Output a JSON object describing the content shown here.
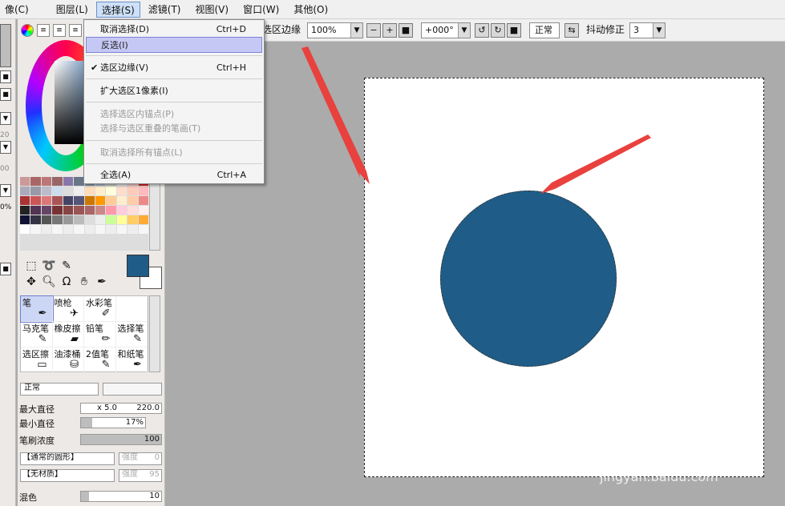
{
  "menubar": {
    "items": [
      "像(C)",
      "图层(L)",
      "选择(S)",
      "滤镜(T)",
      "视图(V)",
      "窗口(W)",
      "其他(O)"
    ]
  },
  "toolbar": {
    "selection_edge_label": "选区边缘",
    "zoom": "100%",
    "angle": "+000°",
    "blend": "正常",
    "stabilizer_label": "抖动修正",
    "stabilizer_value": "3"
  },
  "select_menu": {
    "items": [
      {
        "label": "取消选择(D)",
        "shortcut": "Ctrl+D",
        "state": "normal"
      },
      {
        "label": "反选(I)",
        "shortcut": "",
        "state": "highlighted"
      },
      {
        "label": "选区边缘(V)",
        "shortcut": "Ctrl+H",
        "state": "checked"
      },
      {
        "label": "扩大选区1像素(I)",
        "shortcut": "",
        "state": "normal"
      },
      {
        "label": "选择选区内锚点(P)",
        "shortcut": "",
        "state": "disabled"
      },
      {
        "label": "选择与选区重叠的笔画(T)",
        "shortcut": "",
        "state": "disabled"
      },
      {
        "label": "取消选择所有锚点(L)",
        "shortcut": "",
        "state": "disabled"
      },
      {
        "label": "全选(A)",
        "shortcut": "Ctrl+A",
        "state": "normal"
      }
    ]
  },
  "left_edge": {
    "values": [
      "20",
      "00",
      "0%"
    ]
  },
  "colors": {
    "foreground": "#1f5d88",
    "background": "#ffffff",
    "accent_highlight": "#c5c8f4"
  },
  "brushes": [
    {
      "name": "笔",
      "icon": "pen-icon"
    },
    {
      "name": "喷枪",
      "icon": "airbrush-icon"
    },
    {
      "name": "水彩笔",
      "icon": "watercolor-icon"
    },
    {
      "name": "",
      "icon": ""
    },
    {
      "name": "马克笔",
      "icon": "marker-icon"
    },
    {
      "name": "橡皮擦",
      "icon": "eraser-icon"
    },
    {
      "name": "铅笔",
      "icon": "pencil-icon"
    },
    {
      "name": "选择笔",
      "icon": "select-pen-icon"
    },
    {
      "name": "选区擦",
      "icon": "select-eraser-icon"
    },
    {
      "name": "油漆桶",
      "icon": "bucket-icon"
    },
    {
      "name": "2值笔",
      "icon": "binary-pen-icon"
    },
    {
      "name": "和纸笔",
      "icon": "washi-pen-icon"
    }
  ],
  "brush_settings": {
    "blend_mode": "正常",
    "max_diameter_label": "最大直径",
    "max_diameter_multiplier": "x 5.0",
    "max_diameter_value": "220.0",
    "min_diameter_label": "最小直径",
    "min_diameter_value": "17%",
    "min_diameter_fraction": 0.17,
    "density_label": "笔刷浓度",
    "density_value": "100",
    "density_fraction": 1.0,
    "shape_select": "【通常的圆形】",
    "shape_strength_label": "强度",
    "shape_strength_value": "0",
    "texture_select": "【无材质】",
    "texture_strength_label": "强度",
    "texture_strength_value": "95",
    "mix_label": "混色",
    "mix_value": "10",
    "mix_fraction": 0.1
  },
  "watermark": {
    "brand": "Bai du 经验",
    "url": "jingyan.baidu.com"
  }
}
